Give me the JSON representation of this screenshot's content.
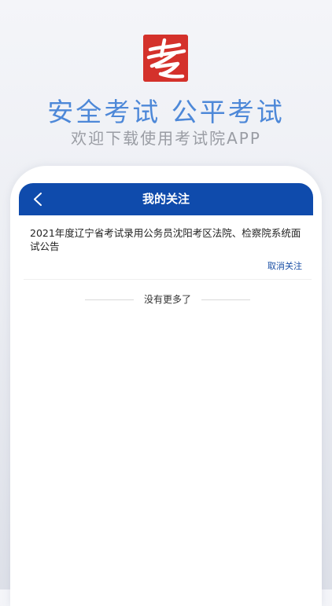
{
  "brand": {
    "logo_icon": "kao-exam-logo-icon",
    "logo_color": "#d4312b",
    "slogan": "安全考试 公平考试",
    "subslogan": "欢迎下载使用考试院APP",
    "slogan_color": "#4d88d8"
  },
  "header": {
    "title": "我的关注",
    "back_icon": "chevron-left-icon",
    "color": "#0f4bac"
  },
  "list": {
    "items": [
      {
        "title": "2021年度辽宁省考试录用公务员沈阳考区法院、检察院系统面试公告",
        "action": "取消关注"
      }
    ],
    "end_text": "没有更多了"
  }
}
